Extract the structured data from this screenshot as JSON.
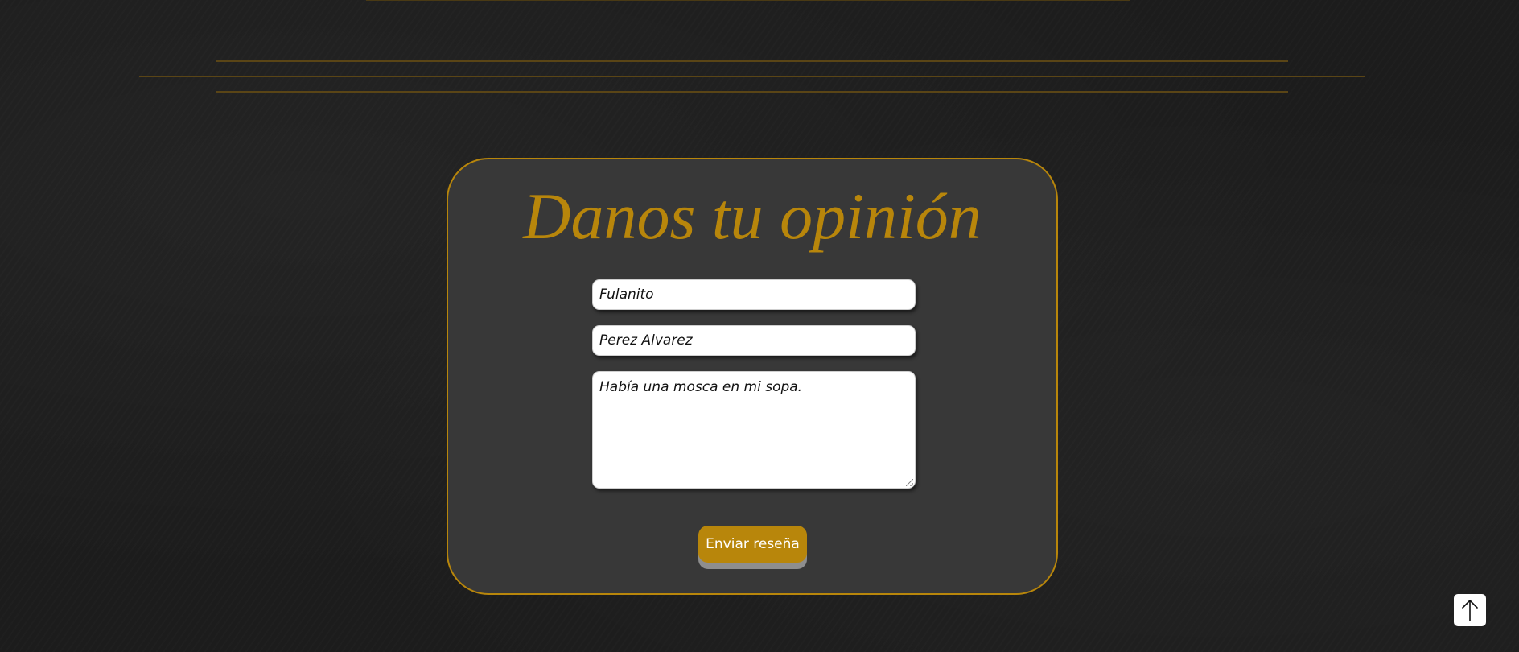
{
  "form": {
    "title": "Danos tu opinión",
    "first_name_value": "Fulanito",
    "last_name_value": "Perez Alvarez",
    "comment_value": "Había una mosca en mi sopa.",
    "submit_label": "Enviar reseña"
  },
  "icons": {
    "scroll_top": "arrow-up-icon"
  },
  "colors": {
    "accent": "#b8860b",
    "card_background": "#383838",
    "page_background": "#1c1c1c",
    "submit_shadow": "#8e8e8e"
  }
}
